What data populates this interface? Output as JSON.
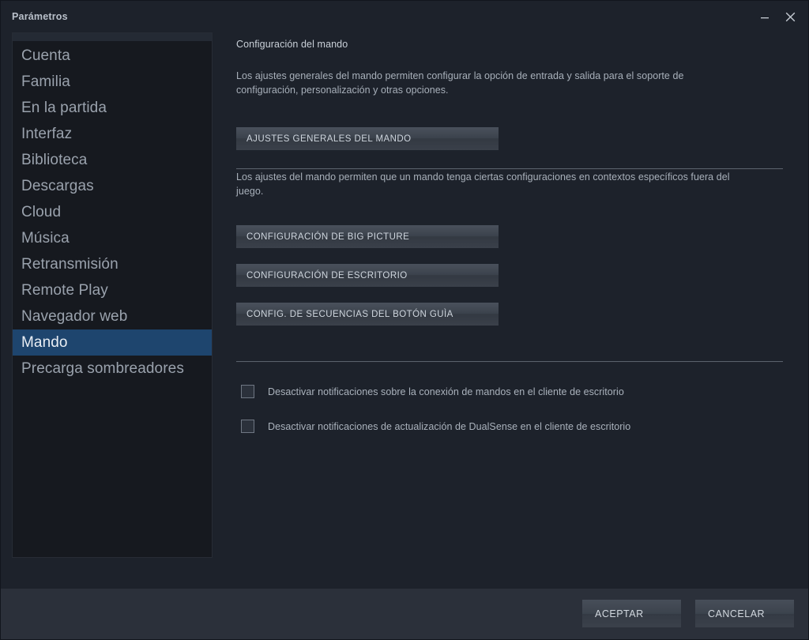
{
  "window": {
    "title": "Parámetros",
    "controls": {
      "minimize": "minimize",
      "close": "close"
    }
  },
  "sidebar": {
    "items": [
      {
        "label": "Cuenta",
        "selected": false
      },
      {
        "label": "Familia",
        "selected": false
      },
      {
        "label": "En la partida",
        "selected": false
      },
      {
        "label": "Interfaz",
        "selected": false
      },
      {
        "label": "Biblioteca",
        "selected": false
      },
      {
        "label": "Descargas",
        "selected": false
      },
      {
        "label": "Cloud",
        "selected": false
      },
      {
        "label": "Música",
        "selected": false
      },
      {
        "label": "Retransmisión",
        "selected": false
      },
      {
        "label": "Remote Play",
        "selected": false
      },
      {
        "label": "Navegador web",
        "selected": false
      },
      {
        "label": "Mando",
        "selected": true
      },
      {
        "label": "Precarga sombreadores",
        "selected": false
      }
    ]
  },
  "main": {
    "title": "Configuración del mando",
    "paragraph_1": "Los ajustes generales del mando permiten configurar la opción de entrada y salida para el soporte de configuración, personalización y otras opciones.",
    "general_settings_button": "AJUSTES GENERALES DEL MANDO",
    "paragraph_2": "Los ajustes del mando permiten que un mando tenga ciertas configuraciones en contextos específicos fuera del juego.",
    "big_picture_button": "CONFIGURACIÓN DE BIG PICTURE",
    "desktop_button": "CONFIGURACIÓN DE ESCRITORIO",
    "guide_button": "CONFIG. DE SECUENCIAS DEL BOTÓN GUÌA",
    "checkboxes": [
      {
        "label": "Desactivar notificaciones sobre la conexión de mandos en el cliente de escritorio",
        "checked": false
      },
      {
        "label": "Desactivar notificaciones de actualización de DualSense en el cliente de escritorio",
        "checked": false
      }
    ]
  },
  "footer": {
    "accept_label": "ACEPTAR",
    "cancel_label": "CANCELAR"
  },
  "colors": {
    "window_bg": "#1d222b",
    "content_bg": "#2b303a",
    "sidebar_bg": "#16191f",
    "selection_blue": "#1e456e",
    "text_primary": "#c9d0d8",
    "text_secondary": "#a8b0ba",
    "divider": "#5a616c"
  }
}
